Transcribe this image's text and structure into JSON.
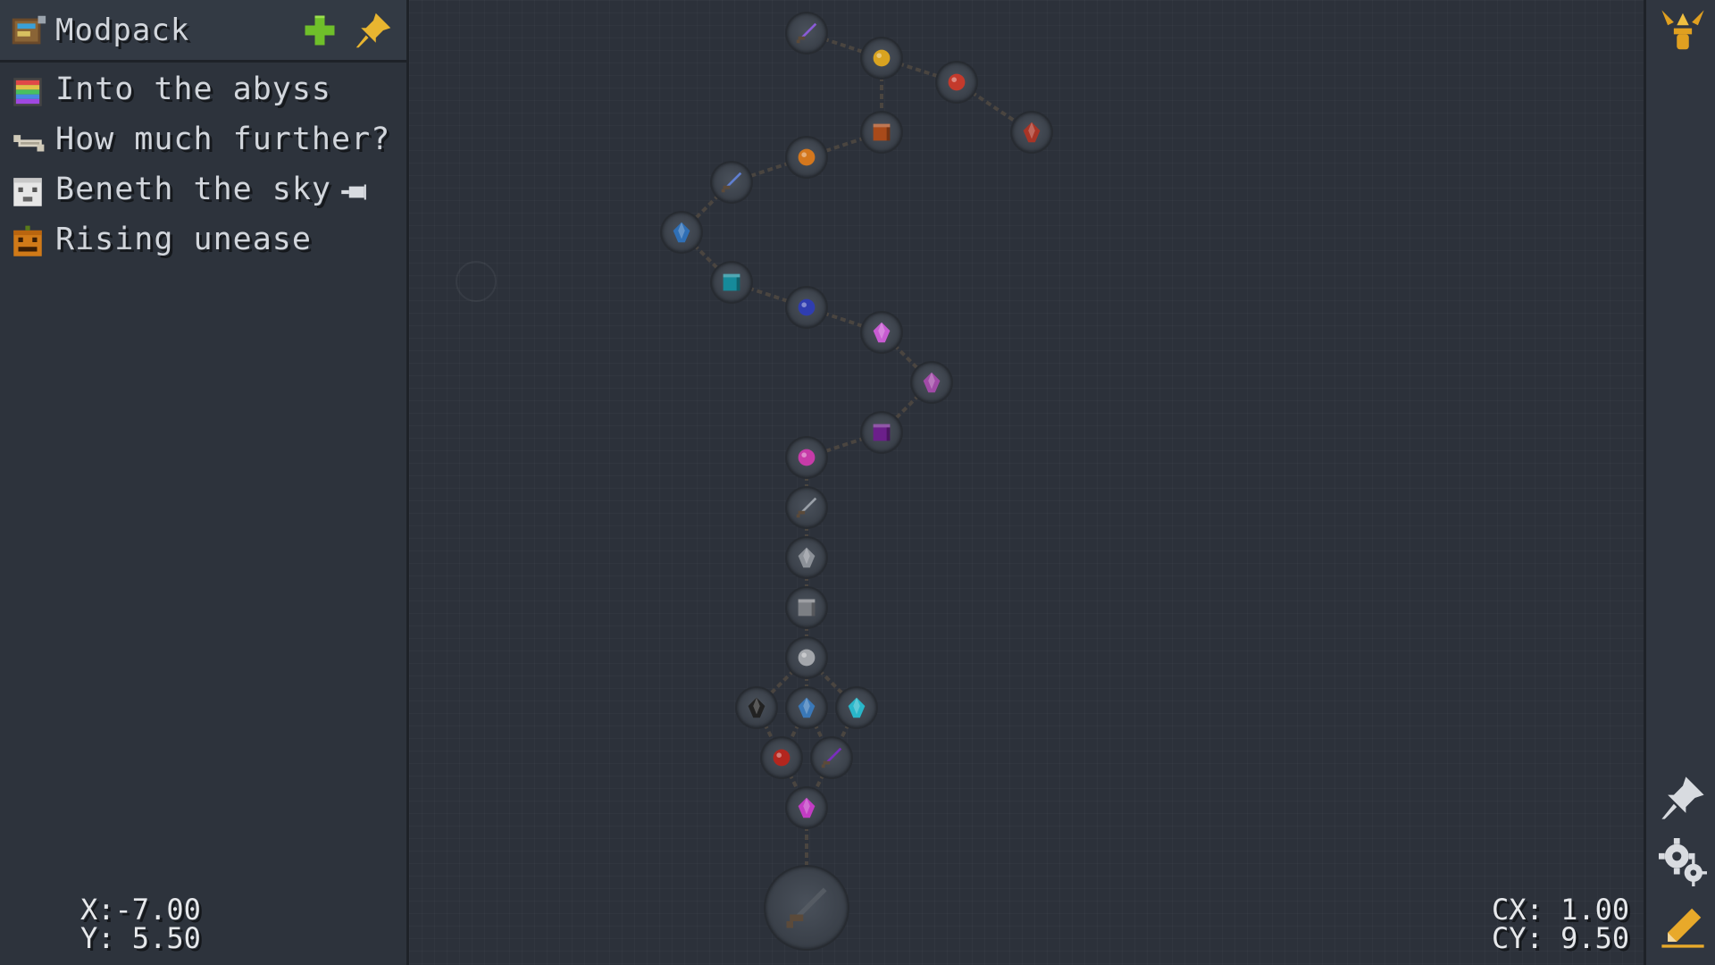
{
  "sidebar": {
    "title": "Modpack",
    "chapters": [
      {
        "label": "Into the abyss",
        "icon": "rainbow-book-icon"
      },
      {
        "label": "How much further?",
        "icon": "bone-icon"
      },
      {
        "label": "Beneth the sky",
        "icon": "ghast-face-icon",
        "pinned": true
      },
      {
        "label": "Rising unease",
        "icon": "carved-pumpkin-icon"
      }
    ],
    "cursor_coords": {
      "x": "X:-7.00",
      "y": "Y: 5.50"
    }
  },
  "canvas": {
    "center_coords": {
      "cx": "CX: 1.00",
      "cy": "CY: 9.50"
    },
    "quests": [
      {
        "id": "q1",
        "icon": "purple-sword-icon",
        "color": "#8a5bd6"
      },
      {
        "id": "q2",
        "icon": "gold-nugget-icon",
        "color": "#d9a320"
      },
      {
        "id": "q3",
        "icon": "shield-medallion-icon",
        "color": "#c43a2c"
      },
      {
        "id": "q4",
        "icon": "red-brick-stairs-icon",
        "color": "#a83426"
      },
      {
        "id": "q5",
        "icon": "copper-block-icon",
        "color": "#a84a1a"
      },
      {
        "id": "q6",
        "icon": "blaze-face-icon",
        "color": "#d4771d"
      },
      {
        "id": "q7",
        "icon": "blue-dagger-icon",
        "color": "#5f7fd1"
      },
      {
        "id": "q8",
        "icon": "blue-fish-icon",
        "color": "#2f6fb5"
      },
      {
        "id": "q9",
        "icon": "warped-block-icon",
        "color": "#168a9a"
      },
      {
        "id": "q10",
        "icon": "dark-blue-orb-icon",
        "color": "#2f3db0"
      },
      {
        "id": "q11",
        "icon": "pink-crystal-icon",
        "color": "#c75bd1"
      },
      {
        "id": "q12",
        "icon": "purple-chestplate-icon",
        "color": "#a04aa6"
      },
      {
        "id": "q13",
        "icon": "purple-block-icon",
        "color": "#6b1f8a"
      },
      {
        "id": "q14",
        "icon": "magenta-orb-icon",
        "color": "#c73ba8"
      },
      {
        "id": "q15",
        "icon": "gray-sword-icon",
        "color": "#9aa0a8"
      },
      {
        "id": "q16",
        "icon": "gray-gear-icon",
        "color": "#8c9198"
      },
      {
        "id": "q17",
        "icon": "stone-block-icon",
        "color": "#7c7f84"
      },
      {
        "id": "q18",
        "icon": "gray-face-icon",
        "color": "#a3a6ab"
      },
      {
        "id": "q19",
        "icon": "black-feather-icon",
        "color": "#222222"
      },
      {
        "id": "q20",
        "icon": "blue-lantern-icon",
        "color": "#3a78b8"
      },
      {
        "id": "q21",
        "icon": "cyan-crystal-icon",
        "color": "#29b6c9"
      },
      {
        "id": "q22",
        "icon": "red-pearl-icon",
        "color": "#b3261e"
      },
      {
        "id": "q23",
        "icon": "violet-blade-icon",
        "color": "#7a2dbd"
      },
      {
        "id": "q24",
        "icon": "magenta-key-icon",
        "color": "#c23cc4"
      },
      {
        "id": "q25",
        "icon": "dark-greatsword-icon",
        "color": "#555b63"
      }
    ]
  },
  "toolbar": {
    "buttons": [
      {
        "name": "quest-book-icon",
        "color": "#e0a020"
      },
      {
        "name": "pin-icon",
        "color": "#d8dbe0"
      },
      {
        "name": "settings-gears-icon",
        "color": "#d8dbe0"
      },
      {
        "name": "edit-pencil-icon",
        "color": "#e8a92a"
      }
    ]
  }
}
